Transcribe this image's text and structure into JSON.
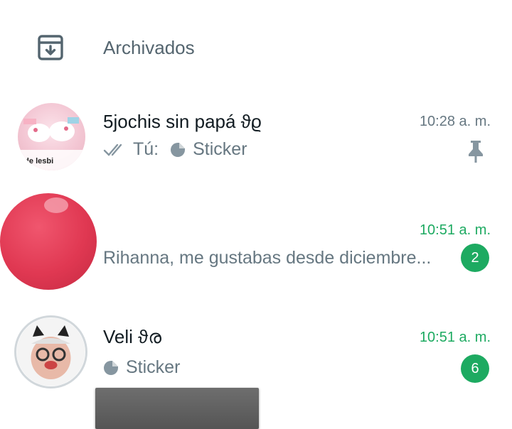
{
  "archived": {
    "label": "Archivados",
    "icon": "archive-icon"
  },
  "chats": [
    {
      "name": "5jochis sin papá ϑϱ",
      "time": "10:28 a. m.",
      "time_color": "#667781",
      "preview_prefix": "Tú:",
      "preview_text": "Sticker",
      "pinned": true,
      "avatar_caption": "a de lesbi",
      "delivery": "double-check-icon"
    },
    {
      "name": "",
      "name_redacted": true,
      "time": "10:51 a. m.",
      "time_color": "#1daa61",
      "preview_text": "Rihanna, me gustabas desde diciembre...",
      "unread": "2"
    },
    {
      "name": "Veli ϑര",
      "time": "10:51 a. m.",
      "time_color": "#1daa61",
      "preview_text": "Sticker",
      "unread": "6"
    }
  ],
  "colors": {
    "accent": "#1daa61",
    "muted": "#667781",
    "text": "#111b21"
  }
}
